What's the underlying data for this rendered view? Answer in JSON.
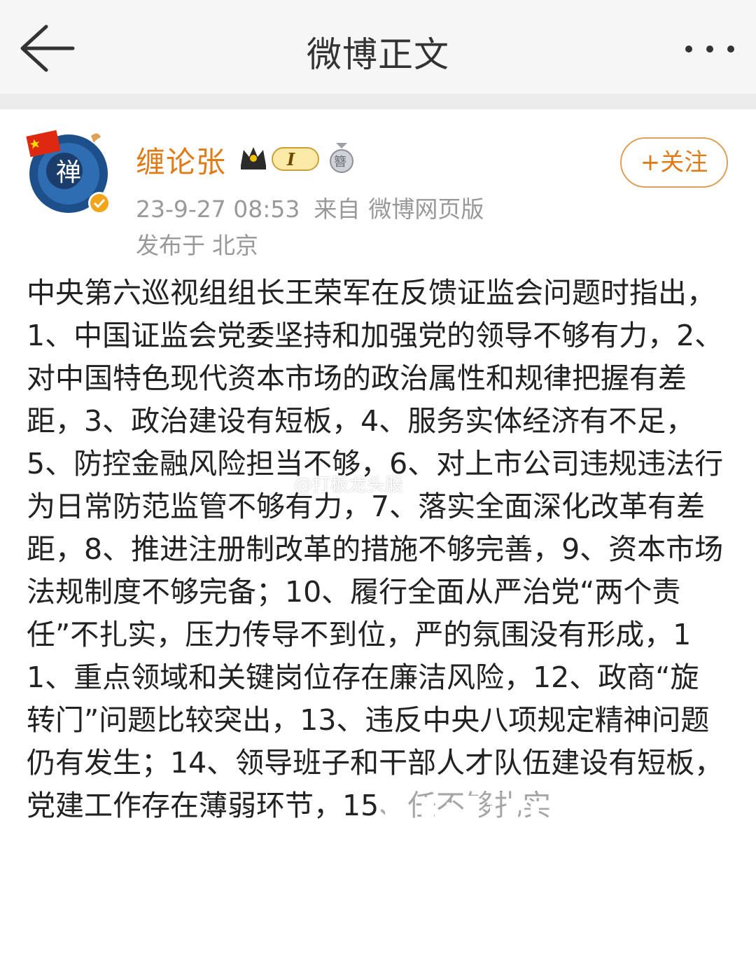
{
  "header": {
    "title": "微博正文",
    "back_icon": "arrow-left-icon",
    "more_icon": "more-dots-icon"
  },
  "user": {
    "name": "缠论张",
    "avatar_char": "禅",
    "level": "I",
    "medal_char": "簪",
    "follow_label": "+关注",
    "accent_color": "#e07b1a"
  },
  "meta": {
    "time": "23-9-27 08:53",
    "source_label": "来自",
    "source": "微博网页版",
    "location_label": "发布于",
    "location": "北京"
  },
  "post": {
    "text": "中央第六巡视组组长王荣军在反馈证监会问题时指出，1、中国证监会党委坚持和加强党的领导不够有力，2、对中国特色现代资本市场的政治属性和规律把握有差距，3、政治建设有短板，4、服务实体经济有不足，5、防控金融风险担当不够，6、对上市公司违规违法行为日常防范监管不够有力，7、落实全面深化改革有差距，8、推进注册制改革的措施不够完善，9、资本市场法规制度不够完备；10、履行全面从严治党“两个责任”不扎实，压力传导不到位，严的氛围没有形成，11、重点领域和关键岗位存在廉洁风险，12、政商“旋转门”问题比较突出，13、违反中央八项规定精神问题仍有发生；14、领导班子和干部人才队伍建设有短板，党建工作存在薄弱环节，15、任不够扎实。",
    "watermark": "@打板龙头股"
  }
}
